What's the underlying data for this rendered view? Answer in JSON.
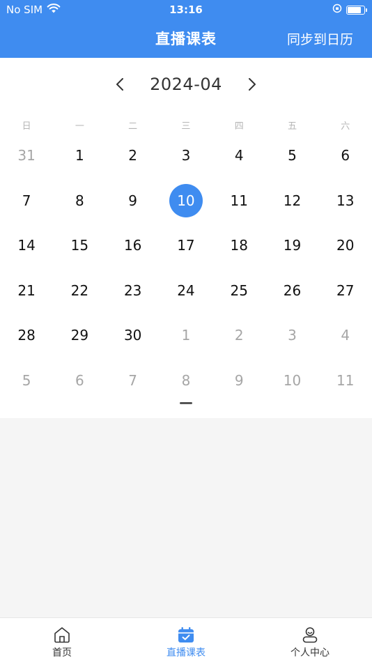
{
  "status_bar": {
    "carrier": "No SIM",
    "time": "13:16"
  },
  "nav": {
    "title": "直播课表",
    "action": "同步到日历"
  },
  "calendar": {
    "month": "2024-04",
    "weekdays": [
      "日",
      "一",
      "二",
      "三",
      "四",
      "五",
      "六"
    ],
    "weeks": [
      [
        {
          "d": "31",
          "m": true
        },
        {
          "d": "1"
        },
        {
          "d": "2"
        },
        {
          "d": "3"
        },
        {
          "d": "4"
        },
        {
          "d": "5"
        },
        {
          "d": "6"
        }
      ],
      [
        {
          "d": "7"
        },
        {
          "d": "8"
        },
        {
          "d": "9"
        },
        {
          "d": "10",
          "s": true
        },
        {
          "d": "11"
        },
        {
          "d": "12"
        },
        {
          "d": "13"
        }
      ],
      [
        {
          "d": "14"
        },
        {
          "d": "15"
        },
        {
          "d": "16"
        },
        {
          "d": "17"
        },
        {
          "d": "18"
        },
        {
          "d": "19"
        },
        {
          "d": "20"
        }
      ],
      [
        {
          "d": "21"
        },
        {
          "d": "22"
        },
        {
          "d": "23"
        },
        {
          "d": "24"
        },
        {
          "d": "25"
        },
        {
          "d": "26"
        },
        {
          "d": "27"
        }
      ],
      [
        {
          "d": "28"
        },
        {
          "d": "29"
        },
        {
          "d": "30"
        },
        {
          "d": "1",
          "m": true
        },
        {
          "d": "2",
          "m": true
        },
        {
          "d": "3",
          "m": true
        },
        {
          "d": "4",
          "m": true
        }
      ],
      [
        {
          "d": "5",
          "m": true
        },
        {
          "d": "6",
          "m": true
        },
        {
          "d": "7",
          "m": true
        },
        {
          "d": "8",
          "m": true
        },
        {
          "d": "9",
          "m": true
        },
        {
          "d": "10",
          "m": true
        },
        {
          "d": "11",
          "m": true
        }
      ]
    ]
  },
  "tabbar": {
    "items": [
      {
        "label": "首页",
        "icon": "home-icon"
      },
      {
        "label": "直播课表",
        "icon": "calendar-icon",
        "active": true
      },
      {
        "label": "个人中心",
        "icon": "person-icon"
      }
    ]
  },
  "colors": {
    "accent": "#3f8cf0",
    "muted": "#a6a6a6"
  }
}
